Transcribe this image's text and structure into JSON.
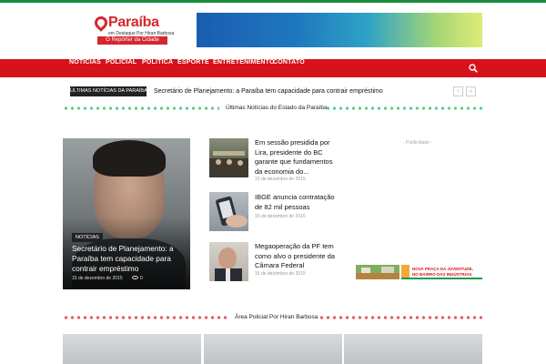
{
  "brand": {
    "name": "Paraíba",
    "subtitle": "em Destaque Por Hiran Barbosa",
    "tagline": "O Repórter da Cidade",
    "primary_color": "#d6121a",
    "accent_color": "#198b3a"
  },
  "nav": {
    "items": [
      {
        "label": "NOTÍCIAS"
      },
      {
        "label": "POLICIAL"
      },
      {
        "label": "POLÍTICA"
      },
      {
        "label": "ESPORTE"
      },
      {
        "label": "ENTRETENIMENTO"
      },
      {
        "label": "CONTATO"
      }
    ],
    "search_icon": "search-icon"
  },
  "ticker": {
    "label": "ÚLTIMAS NOTÍCIAS DA PARAÍBA",
    "text": "Secretário de Planejamento: a Paraíba tem capacidade para contrair empréstimo",
    "prev": "‹",
    "next": "›"
  },
  "sections": {
    "latest_title": "Últimas Notícias do Estado da Paraíba",
    "police_title": "Área Policial Por Hiran Barbosa"
  },
  "featured": {
    "category": "NOTÍCIAS",
    "title": "Secretário de Planejamento: a Paraíba tem capacidade para contrair empréstimo",
    "date": "15 de dezembro de 2015",
    "views": "0"
  },
  "articles": [
    {
      "title": "Em sessão presidida por Lira, presidente do BC garante que fundamentos da economia do...",
      "date": "15 de dezembro de 2015"
    },
    {
      "title": "IBGE anuncia contratação de 82 mil pessoas",
      "date": "15 de dezembro de 2015"
    },
    {
      "title": "Megaoperação da PF tem como alvo o presidente da Câmara Federal",
      "date": "15 de dezembro de 2015"
    }
  ],
  "sidebar": {
    "ad_label": "- Publicidade -",
    "ad_text_1": "NOVA PRAÇA DA JUVENTUDE,",
    "ad_text_2": "NO BAIRRO DAS INDÚSTRIAS."
  }
}
